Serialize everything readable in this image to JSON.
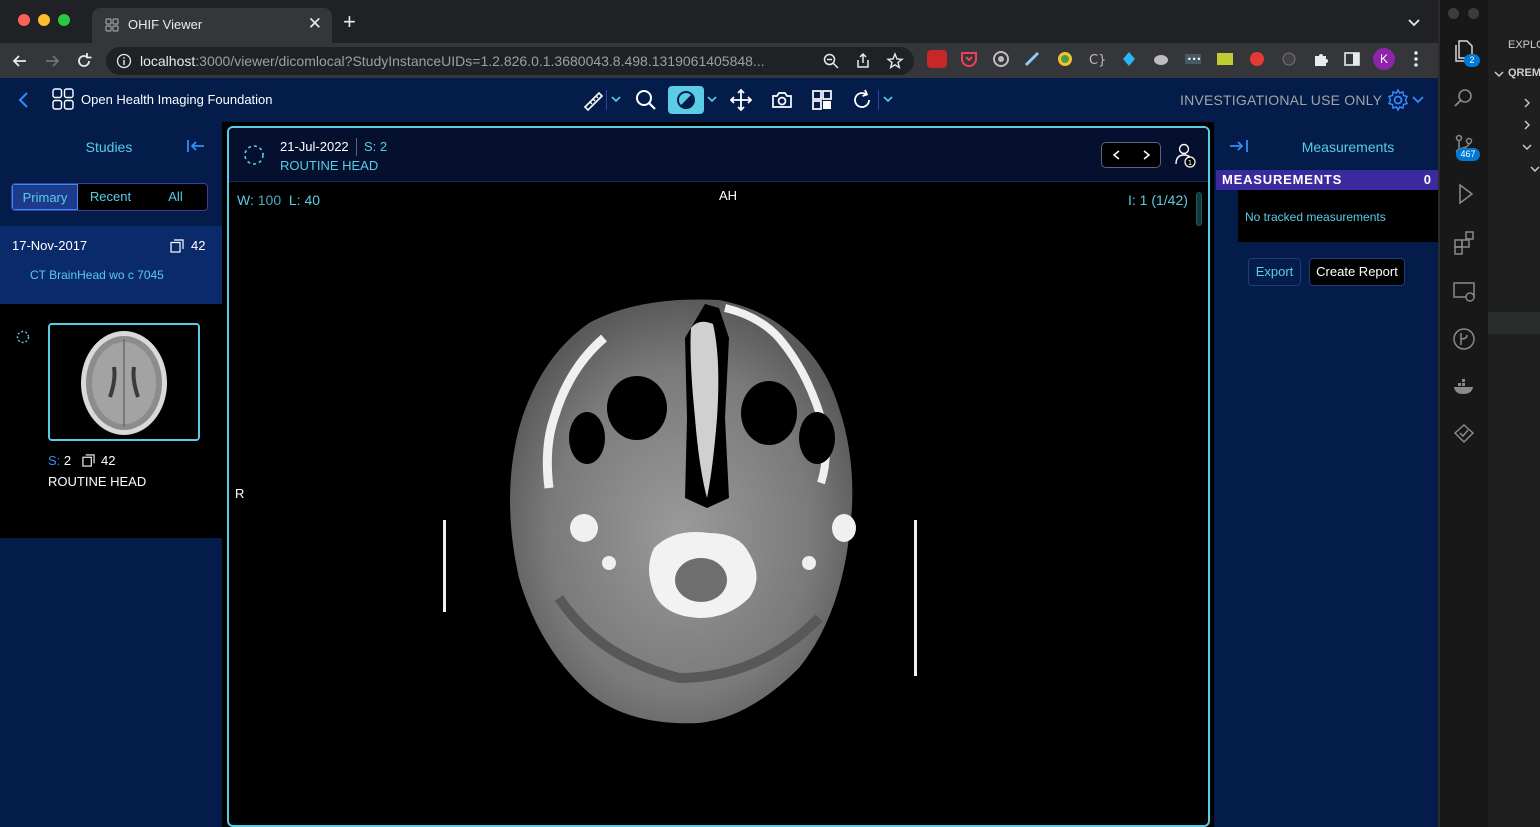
{
  "browser": {
    "tab_title": "OHIF Viewer",
    "url_host": "localhost",
    "url_rest": ":3000/viewer/dicomlocal?StudyInstanceUIDs=1.2.826.0.1.3680043.8.498.1319061405848...",
    "profile_initial": "K"
  },
  "header": {
    "app_title": "Open Health Imaging Foundation",
    "investigational": "INVESTIGATIONAL USE ONLY",
    "tools": [
      "measure-ruler-icon",
      "zoom-icon",
      "window-level-icon",
      "pan-icon",
      "capture-icon",
      "layout-icon",
      "rotate-icon"
    ]
  },
  "studies_panel": {
    "title": "Studies",
    "tabs": [
      {
        "label": "Primary",
        "active": true
      },
      {
        "label": "Recent",
        "active": false
      },
      {
        "label": "All",
        "active": false
      }
    ],
    "study": {
      "date": "17-Nov-2017",
      "instance_count": "42",
      "description": "CT BrainHead wo c 7045"
    },
    "series": {
      "series_label": "S:",
      "series_number": "2",
      "instance_count": "42",
      "description": "ROUTINE HEAD"
    }
  },
  "viewport": {
    "date": "21-Jul-2022",
    "series_label": "S: 2",
    "description": "ROUTINE HEAD",
    "user_badge": "1",
    "window_label": "W:",
    "window_value": "100",
    "level_label": "L:",
    "level_value": "40",
    "orientation_top": "AH",
    "orientation_left": "R",
    "instance_label": "I:",
    "instance_value": "1 (1/42)"
  },
  "measurements_panel": {
    "title": "Measurements",
    "section_label": "MEASUREMENTS",
    "count": "0",
    "empty_text": "No tracked measurements",
    "export_label": "Export",
    "create_report_label": "Create Report"
  },
  "vscode": {
    "explorer_label": "EXPLO",
    "folder_label": "QREM",
    "source_control_badge": "467",
    "explorer_badge": "2"
  },
  "colors": {
    "accent": "#5acce6",
    "primary_blue": "#348cfd",
    "panel_bg": "#041c4a",
    "measure_bar": "#3b2a9e"
  }
}
